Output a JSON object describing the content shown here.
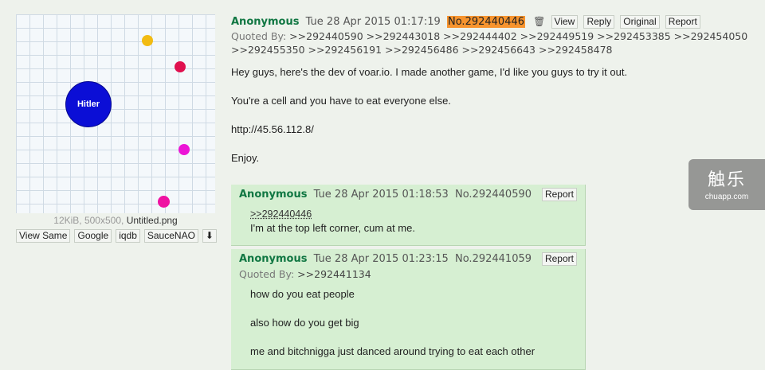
{
  "thumbnail": {
    "cell_label": "Hitler",
    "meta_size": "12KiB, 500x500,",
    "filename": "Untitled.png",
    "tools": [
      "View Same",
      "Google",
      "iqdb",
      "SauceNAO",
      "⬇"
    ]
  },
  "op": {
    "name": "Anonymous",
    "date": "Tue 28 Apr 2015 01:17:19",
    "number": "No.292440446",
    "trash_icon": "🗑",
    "buttons": [
      "View",
      "Reply",
      "Original",
      "Report"
    ],
    "quoted_label": "Quoted By:",
    "quoted_line1": ">>292440590 >>292443018 >>292444402 >>292449519 >>292453385 >>292454050",
    "quoted_line2": ">>292455350 >>292456191 >>292456486 >>292456643 >>292458478",
    "body": [
      "Hey guys, here's the dev of voar.io. I made another game, I'd like you guys to try it out.",
      "You're a cell and you have to eat everyone else.",
      "http://45.56.112.8/",
      "Enjoy."
    ]
  },
  "reply1": {
    "name": "Anonymous",
    "date": "Tue 28 Apr 2015 01:18:53",
    "number": "No.292440590",
    "report": "Report",
    "quote": ">>292440446",
    "body": "I'm at the top left corner, cum at me."
  },
  "reply2": {
    "name": "Anonymous",
    "date": "Tue 28 Apr 2015 01:23:15",
    "number": "No.292441059",
    "report": "Report",
    "quoted_label": "Quoted By:",
    "quoted": ">>292441134",
    "body": [
      "how do you eat people",
      "also how do you get big",
      "me and bitchnigga just danced around trying to eat each other"
    ]
  },
  "watermark": {
    "big": "触乐",
    "small": "chuapp.com"
  }
}
